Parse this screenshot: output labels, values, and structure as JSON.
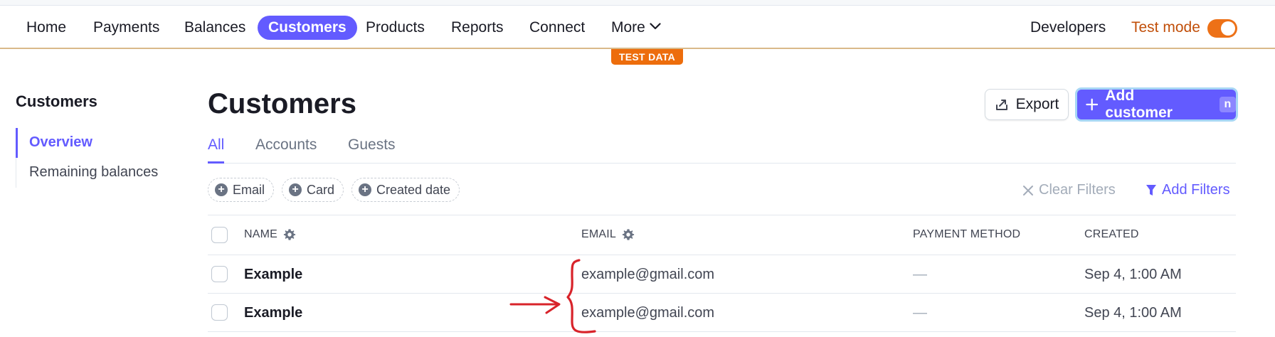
{
  "nav": {
    "items": [
      {
        "label": "Home",
        "active": false
      },
      {
        "label": "Payments",
        "active": false
      },
      {
        "label": "Balances",
        "active": false
      },
      {
        "label": "Customers",
        "active": true
      },
      {
        "label": "Products",
        "active": false
      },
      {
        "label": "Reports",
        "active": false
      },
      {
        "label": "Connect",
        "active": false
      },
      {
        "label": "More",
        "active": false
      }
    ],
    "developers": "Developers",
    "test_mode_label": "Test mode",
    "test_mode_on": true,
    "test_data_badge": "TEST DATA"
  },
  "sidebar": {
    "title": "Customers",
    "items": [
      {
        "label": "Overview",
        "active": true
      },
      {
        "label": "Remaining balances",
        "active": false
      }
    ]
  },
  "main": {
    "title": "Customers",
    "export_label": "Export",
    "add_label": "Add customer",
    "add_shortcut": "n",
    "tabs": [
      {
        "label": "All",
        "active": true
      },
      {
        "label": "Accounts",
        "active": false
      },
      {
        "label": "Guests",
        "active": false
      }
    ],
    "filter_chips": [
      "Email",
      "Card",
      "Created date"
    ],
    "clear_filters": "Clear Filters",
    "add_filters": "Add Filters"
  },
  "table": {
    "columns": [
      "NAME",
      "EMAIL",
      "PAYMENT METHOD",
      "CREATED"
    ],
    "rows": [
      {
        "name": "Example",
        "email": "example@gmail.com",
        "payment_method": "—",
        "created": "Sep 4, 1:00 AM"
      },
      {
        "name": "Example",
        "email": "example@gmail.com",
        "payment_method": "—",
        "created": "Sep 4, 1:00 AM"
      }
    ]
  },
  "colors": {
    "accent": "#635bff",
    "test_mode": "#ed6d0c",
    "annotation": "#d8232a"
  }
}
